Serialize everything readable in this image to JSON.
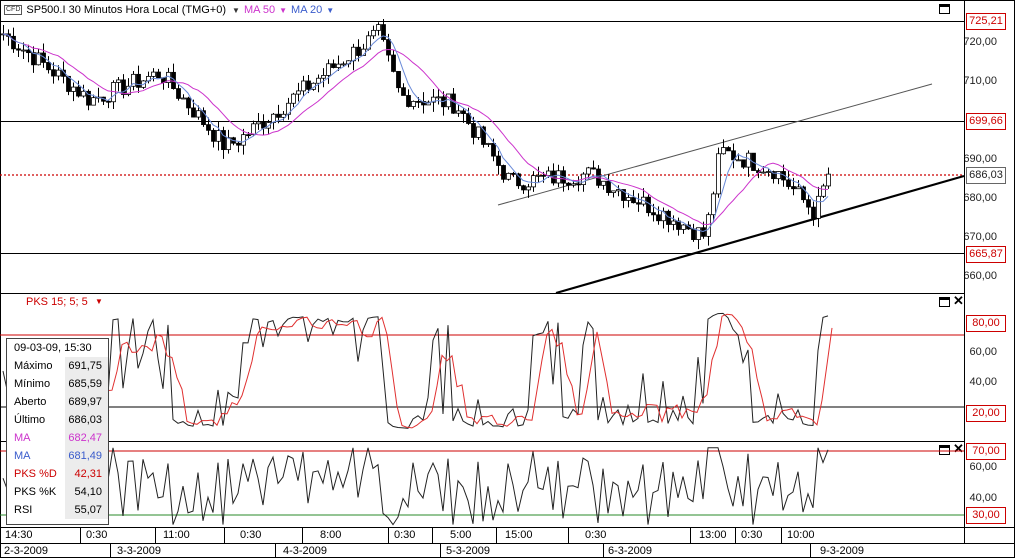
{
  "header": {
    "badge": "CFD",
    "symbol_label": "SP500.I 30 Minutos Hora Local (TMG+0)",
    "ma50_label": "MA 50",
    "ma20_label": "MA 20"
  },
  "price_axis": {
    "ticks": [
      "720,00",
      "710,00",
      "690,00",
      "680,00",
      "670,00",
      "660,00"
    ],
    "boxes": {
      "top": "725,21",
      "resistance": "699,66",
      "last": "686,03",
      "support": "665,87"
    }
  },
  "stoch_panel": {
    "label": "PKS 15; 5; 5",
    "ticks": [
      "60,00",
      "40,00"
    ],
    "boxes": {
      "upper": "80,00",
      "lower": "20,00"
    }
  },
  "rsi_panel": {
    "ticks": [
      "60,00",
      "40,00"
    ],
    "boxes": {
      "upper": "70,00",
      "lower": "30,00"
    }
  },
  "info_box": {
    "date": "09-03-09, 15:30",
    "rows": [
      {
        "k": "Máximo",
        "v": "691,75",
        "color": "#000000"
      },
      {
        "k": "Mínimo",
        "v": "685,59",
        "color": "#000000"
      },
      {
        "k": "Aberto",
        "v": "689,97",
        "color": "#000000"
      },
      {
        "k": "Último",
        "v": "686,03",
        "color": "#000000"
      },
      {
        "k": "MA",
        "v": "682,47",
        "color": "#cc33cc"
      },
      {
        "k": "MA",
        "v": "681,49",
        "color": "#3a5ccc"
      },
      {
        "k": "PKS %D",
        "v": "42,31",
        "color": "#cc0000"
      },
      {
        "k": "PKS %K",
        "v": "54,10",
        "color": "#000000"
      },
      {
        "k": "RSI",
        "v": "55,07",
        "color": "#000000"
      }
    ]
  },
  "time_axis": {
    "top": [
      "14:30",
      "0:30",
      "11:00",
      "0:30",
      "8:00",
      "0:30",
      "5:00",
      "15:00",
      "0:30",
      "13:00",
      "0:30",
      "10:00"
    ],
    "bottom": [
      "2-3-2009",
      "3-3-2009",
      "4-3-2009",
      "5-3-2009",
      "6-3-2009",
      "9-3-2009"
    ]
  },
  "chart_data": {
    "type": "candlestick",
    "price_series_approx": [
      {
        "x": "2-3-2009 14:30",
        "y": 722
      },
      {
        "x": "3-3-2009 0:30",
        "y": 705
      },
      {
        "x": "3-3-2009 11:00",
        "y": 712
      },
      {
        "x": "3-3-2009",
        "y": 693
      },
      {
        "x": "4-3-2009 0:30",
        "y": 695
      },
      {
        "x": "4-3-2009 8:00",
        "y": 713
      },
      {
        "x": "4-3-2009",
        "y": 722
      },
      {
        "x": "5-3-2009 0:30",
        "y": 706
      },
      {
        "x": "5-3-2009 5:00",
        "y": 704
      },
      {
        "x": "5-3-2009 15:00",
        "y": 684
      },
      {
        "x": "6-3-2009 0:30",
        "y": 686
      },
      {
        "x": "6-3-2009 13:00",
        "y": 670
      },
      {
        "x": "6-3-2009",
        "y": 692
      },
      {
        "x": "9-3-2009 0:30",
        "y": 687
      },
      {
        "x": "9-3-2009 10:00",
        "y": 676
      },
      {
        "x": "9-3-2009 15:30",
        "y": 686
      }
    ],
    "ylim": [
      655,
      728
    ],
    "stoch_ylim": [
      0,
      100
    ],
    "rsi_ylim": [
      20,
      75
    ],
    "grid": false
  }
}
